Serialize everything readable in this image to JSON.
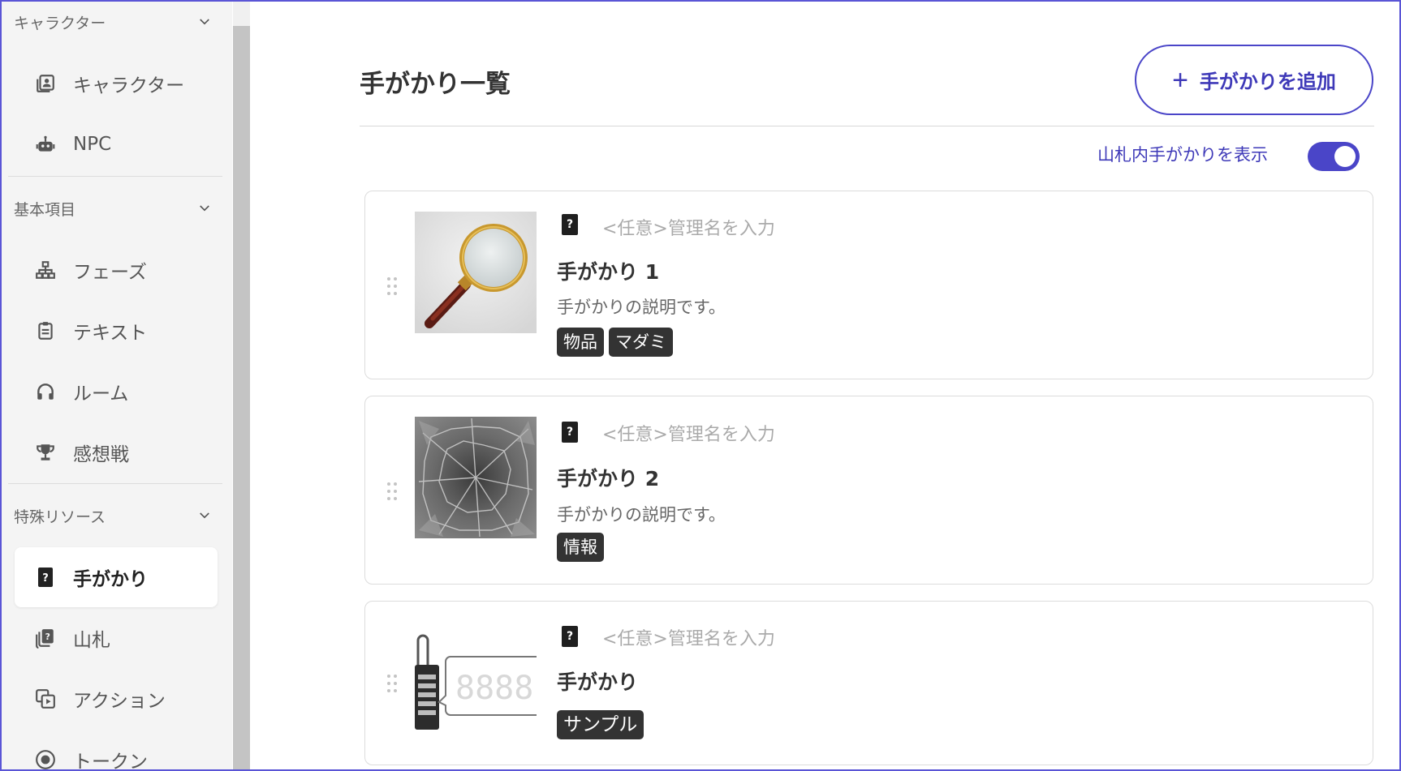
{
  "sidebar": {
    "sections": [
      {
        "label": "キャラクター"
      },
      {
        "label": "基本項目"
      },
      {
        "label": "特殊リソース"
      }
    ],
    "items": [
      {
        "label": "キャラクター",
        "icon": "portrait-icon"
      },
      {
        "label": "NPC",
        "icon": "robot-icon"
      },
      {
        "label": "フェーズ",
        "icon": "sitemap-icon"
      },
      {
        "label": "テキスト",
        "icon": "clipboard-icon"
      },
      {
        "label": "ルーム",
        "icon": "headphones-icon"
      },
      {
        "label": "感想戦",
        "icon": "trophy-icon"
      },
      {
        "label": "手がかり",
        "icon": "clue-card-icon",
        "active": true
      },
      {
        "label": "山札",
        "icon": "deck-icon"
      },
      {
        "label": "アクション",
        "icon": "action-icon"
      },
      {
        "label": "トークン",
        "icon": "token-icon"
      }
    ]
  },
  "main": {
    "title": "手がかり一覧",
    "add_button": "手がかりを追加",
    "toggle_label": "山札内手がかりを表示",
    "toggle_on": true,
    "admin_placeholder": "<任意>管理名を入力",
    "clues": [
      {
        "title": "手がかり 1",
        "description": "手がかりの説明です。",
        "tags": [
          "物品",
          "マダミ"
        ],
        "image": "magnifying-glass"
      },
      {
        "title": "手がかり 2",
        "description": "手がかりの説明です。",
        "tags": [
          "情報"
        ],
        "image": "cracked-glass"
      },
      {
        "title": "手がかり",
        "description": "",
        "tags": [
          "サンプル"
        ],
        "image": "padlock-display"
      }
    ]
  },
  "colors": {
    "accent": "#4a45c8",
    "tag_bg": "#333333",
    "sidebar_bg": "#f4f4f4"
  }
}
